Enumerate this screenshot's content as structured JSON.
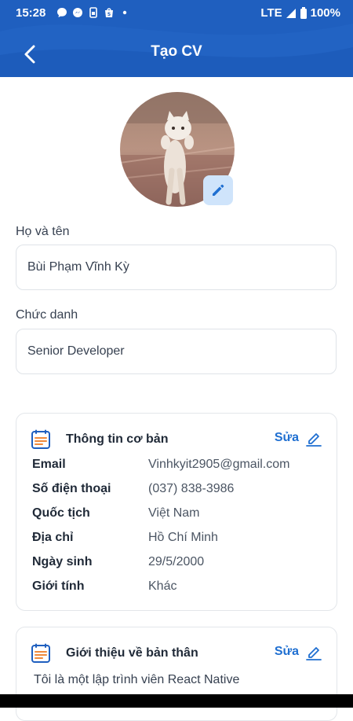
{
  "status_bar": {
    "time": "15:28",
    "network": "LTE",
    "battery": "100%",
    "icons": [
      "chat-icon",
      "messenger-icon",
      "sim-icon",
      "shop-icon",
      "dot-icon",
      "signal-icon",
      "battery-icon"
    ]
  },
  "header": {
    "title": "Tạo CV",
    "color": "#1f5fbf"
  },
  "form": {
    "name_label": "Họ và tên",
    "name_value": "Bùi Phạm Vĩnh Kỳ",
    "title_label": "Chức danh",
    "title_value": "Senior Developer"
  },
  "basic_info": {
    "title": "Thông tin cơ bản",
    "edit_label": "Sửa",
    "rows": [
      {
        "key": "Email",
        "value": "Vinhkyit2905@gmail.com"
      },
      {
        "key": "Số điện thoại",
        "value": "(037) 838-3986"
      },
      {
        "key": "Quốc tịch",
        "value": "Việt Nam"
      },
      {
        "key": "Địa chỉ",
        "value": "Hồ Chí Minh"
      },
      {
        "key": "Ngày sinh",
        "value": "29/5/2000"
      },
      {
        "key": "Giới tính",
        "value": "Khác"
      }
    ]
  },
  "about": {
    "title": "Giới thiệu về bản thân",
    "edit_label": "Sửa",
    "text": "Tôi là một lập trình viên React Native"
  },
  "accent_color": "#1f6fd1"
}
